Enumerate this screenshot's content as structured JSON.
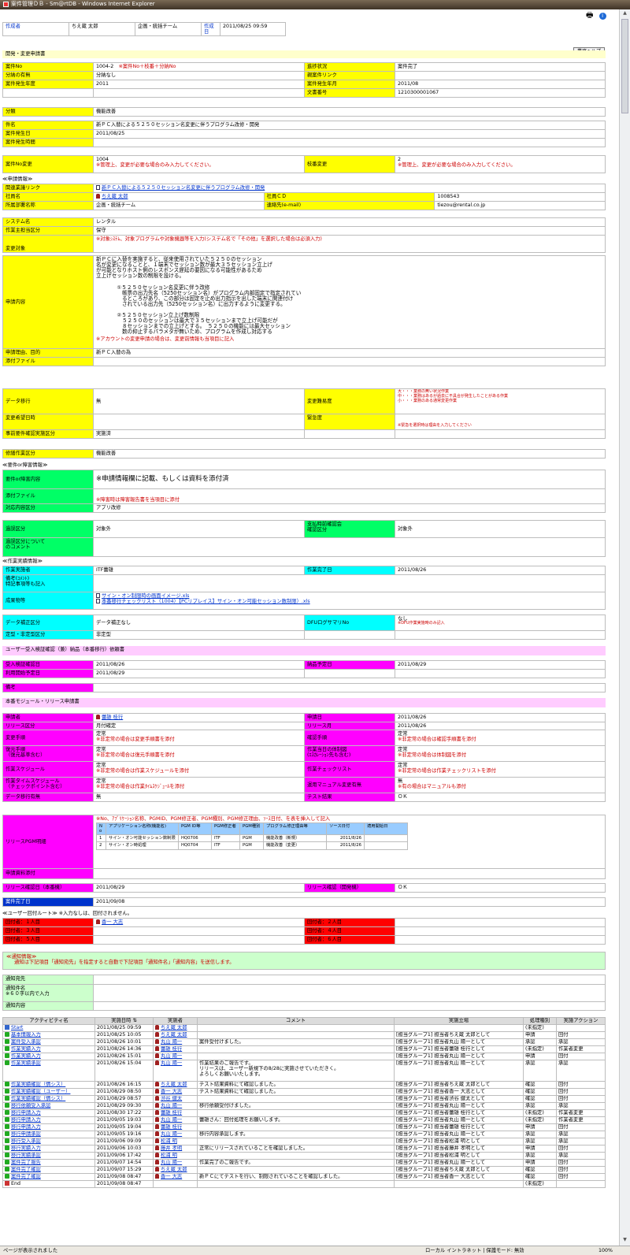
{
  "window": {
    "title": "案件管理ＤＢ - Sm@rtDB - Windows Internet Explorer"
  },
  "icons": {
    "print": "print-icon",
    "help": "help-icon",
    "user": "user-icon",
    "document": "document-icon"
  },
  "colors": {
    "yellow": "#ffff00",
    "green": "#00ff66",
    "cyan": "#00ffff",
    "magenta": "#ff00ff",
    "red": "#ff0000",
    "blue": "#0033cc",
    "pink": "#ffccff",
    "lightgreen": "#ccffcc"
  },
  "header": {
    "author_label": "作成者",
    "author": "ちえ蔵 太郎",
    "team": "企画・統括チーム",
    "date_label": "作成日",
    "date": "2011/08/25 09:59"
  },
  "help_button": "業務ヘルプ",
  "sections": {
    "request": "開発・変更申請書",
    "app_info": "≪申請情報≫",
    "incident": "≪要件or障害情報≫",
    "work": "≪作業実績情報≫",
    "uat": "ユーザー受入検証確認（兼）納品（本番移行）依頼書",
    "release": "本番モジュール・リリース申請書",
    "route": "≪ユーザー回付ルート≫ ※入力なしは、回付されません。",
    "notify": "≪通知情報≫"
  },
  "project": {
    "no_label": "案件No",
    "no": "1004-2",
    "no_note": "※案件No＋枝番＋分納No",
    "progress_label": "進捗状況",
    "progress": "案件完了",
    "split_label": "分納の有無",
    "split": "分納なし",
    "parent_label": "親案件リンク",
    "year_label": "案件発生年度",
    "year": "2011",
    "month_label": "案件発生年月",
    "month": "2011/08",
    "docno_label": "文書番号",
    "docno": "1210300001067",
    "category_label": "分類",
    "category": "機能改善",
    "subject_label": "件名",
    "subject": "新ＰＣ入替による５２５０セッション名変更に伴うプログラム改修・開発",
    "occur_date_label": "案件発生日",
    "occur_date": "2011/08/25",
    "occur_time_label": "案件発生時間",
    "change_no_label": "案件No変更",
    "change_no": "1004",
    "change_no_note": "※管理上、変更が必要な場合のみ入力してください。",
    "branch_label": "枝番変更",
    "branch": "2",
    "branch_note": "※管理上、変更が必要な場合のみ入力してください。"
  },
  "app": {
    "related_label": "関連業議リンク",
    "related_link": "新ＰＣ入替による５２５０セッション名変更に伴うプログラム改修・開発",
    "staff_label": "社員名",
    "staff": "ちえ蔵 太郎",
    "staffcd_label": "社員ＣＤ",
    "staffcd": "1008543",
    "dept_label": "所属部署名称",
    "dept": "企画・統括チーム",
    "mail_label": "連絡先(e-mail)",
    "mail": "tiezou@rental.co.jp",
    "system_label": "システム名",
    "system": "レンタル",
    "work_type_label": "作業主担当区分",
    "work_type": "保守",
    "target_note": "※対象ｼｽﾃﾑ、対象プログラムや対象機器等を入力(システム名で「その他」を選択した場合は必須入力)",
    "target_label": "変更対象",
    "content_label": "申請内容",
    "content": "新ＰＣに入替を実施すると、従来使用されていた５２５０のセッション\n名が変更になることと、１端末でセッション数が最大３５セッション立上げ\nが可能となりホスト側のレスポンス遅延の要因になる可能性があるため\n立上げセッション数の制限を設ける。\n\n　　　　①５２５０セッション名変更に伴う改修\n　　　　　帳票の出力先名（5250セッション名）がプログラム内部固定で指定されてい\n　　　　　るところがあり、この部分は固定を止め出力指示を出した端末に関連付け\n　　　　　されている出力先（5250セッション名）に出力するように変更する。\n\n　　　　②５２５０セッション立上げ数制限\n　　　　　５２５０のセッションは最大で３５セッションまで立上げ可能だが\n　　　　　８セッションまでの立上げとする。　５２５０の機能には最大セッション\n　　　　　数の抑止するパラメタが無いため、プログラムを作成し対応する",
    "content_note": "※アカウントの変更申請の場合は、変更前情報も当項目に記入",
    "reason_label": "申請理由、目的",
    "reason": "新ＰＣ入替の為",
    "attach_label": "添付ファイル",
    "migration_label": "データ移行",
    "migration": "無",
    "difficulty_label": "変更難易度",
    "difficulty_big": "大・・・業務の無い状況作業",
    "difficulty_mid": "中・・・業務はあるが過去に不具合が発生したことがある作業",
    "difficulty_small": "小・・・業務のある通常変更作業",
    "desired_label": "変更希望日時",
    "urgency_label": "緊急度",
    "urgency_note": "※緊急を選択時は理由を入力してください",
    "precheck_label": "事前要件確認実施区分",
    "precheck": "実施済",
    "repair_label": "修繕作業区分",
    "repair": "機能改善"
  },
  "incident": {
    "content_label": "要件or障害内容",
    "content": "※申請情報欄に記載、もしくは資料を添付済",
    "attach_label": "添付ファイル",
    "attach_note": "※障害時は障害報告書を当項目に添付",
    "response_label": "対応内容区分",
    "response": "アプリ改修",
    "fee_label": "過誤区分",
    "fee": "対象外",
    "vendor_label": "支払時前確認会\n確認区分",
    "vendor": "対象外",
    "comment_label": "過誤区分について\nのコメント"
  },
  "work": {
    "worker_label": "作業実施者",
    "worker": "ITF蕾雄",
    "done_label": "作業完了日",
    "done": "2011/08/26",
    "remark_label": "備考(ｺﾒﾝﾄ)\n特記事項等も記入",
    "output_label": "成果物等",
    "output1": "サイン・オン制限時の画面イメージ.xls",
    "output2": "本番移行チェックリスト（1004）【PCリプレイス】サイン・オン可能セッション数制限）.xls",
    "fix_label": "データ補正区分",
    "fix": "データ補正なし",
    "dfu_label": "DFUログサマリNo",
    "dfu": "なし",
    "dfu_note": "※DFU作業実施時のみ記入",
    "type_label": "定型・非定型区分",
    "type": "非定型"
  },
  "uat": {
    "accept_label": "受入検証確認日",
    "accept": "2011/08/26",
    "deliver_label": "納品予定日",
    "deliver": "2011/08/29",
    "start_label": "利用開始予定日",
    "start": "2011/08/29",
    "remark_label": "備考"
  },
  "release": {
    "applicant_label": "申請者",
    "applicant": "蕾雄 桂行",
    "app_date_label": "申請日",
    "app_date": "2011/08/26",
    "rel_type_label": "リリース区分",
    "rel_type": "月付確定",
    "rel_month_label": "リリース月",
    "rel_month": "2011/08/26",
    "procedure_label": "変更手順",
    "procedure": "定常",
    "procedure_note": "※非定常の場合は変更手順書を添付",
    "confirm_label": "確認手順",
    "confirm": "定常",
    "confirm_note": "※非定常の場合は確認手順書を添付",
    "rollback_label": "復元手順\n（復元基準含む）",
    "rollback": "定常",
    "rollback_note": "※非定常の場合は復元手順書を添付",
    "system_label": "作業当日の体制図\n(ｴｽｶﾚｰｼｮﾝ先も含む)",
    "system": "定常",
    "system_note": "※非定常の場合は体制図を添付",
    "schedule_label": "作業スケジュール",
    "schedule": "定常",
    "schedule_note": "※非定常の場合は作業スケジュールを添付",
    "checklist_label": "作業チェックリスト",
    "checklist": "定常",
    "checklist_note": "※非定常の場合は作業チェックリストを添付",
    "timetable_label": "作業タイムスケジュール\n（チェックポイント含む）",
    "timetable": "定常",
    "timetable_note": "※非定常の場合は作業ﾀｲﾑｽｹｼﾞｭｰﾙを添付",
    "manual_label": "運用マニュアル変更有無",
    "manual": "無",
    "manual_note": "※有の場合はマニュアルも添付",
    "datamig_label": "データ移行有無",
    "datamig": "無",
    "test_label": "テスト結果",
    "test": "ＯＫ",
    "pgm_label": "リリースPGM明細",
    "pgm_note": "※No、ｱﾌﾟﾘｹｰｼｮﾝ名称、PGMID、PGM修正者、PGM種別、PGM修正理由、ｿｰｽ日付、を表を挿入して記入",
    "pgm_head": [
      "No",
      "アプリケーション名称(機能名)",
      "PGM ID等",
      "PGM修正者",
      "PGM種別",
      "プログラム修正理由等",
      "ソース日付",
      "適用開始日"
    ],
    "pgm_rows": [
      [
        "1",
        "サイン・オン可能セッション数制限",
        "HQ0706",
        "ITF",
        "PGM",
        "機能改善（新規）",
        "2011/8/26",
        ""
      ],
      [
        "2",
        "サイン・オン時処理",
        "HQ0704",
        "ITF",
        "PGM",
        "機能改善（変更）",
        "2011/8/26",
        ""
      ]
    ],
    "docs_label": "申請資料添付",
    "rel_confirm_label": "リリース確認日（本番機）",
    "rel_confirm": "2011/08/29",
    "rel_check_label": "リリース確認（開発機）",
    "rel_check": "ＯＫ",
    "complete_label": "案件完了日",
    "complete": "2011/09/08"
  },
  "route": {
    "r1": "回付者：１人目",
    "r1v": "香一 大志",
    "r2": "回付者：２人目",
    "r3": "回付者：３人目",
    "r4": "回付者：４人目",
    "r5": "回付者：５人目",
    "r6": "回付者：６人目"
  },
  "notify": {
    "desc": "通知は下記項目「通知宛先」を指定すると自動で下記項目「通知件名」「通知内容」を送信します。",
    "to_label": "通知宛先",
    "subject_label": "通知件名\n※６０字以内で入力",
    "body_label": "通知内容"
  },
  "activity": {
    "headers": [
      "アクティビティ名",
      "実施日時 ⇅",
      "実施者",
      "コメント",
      "実施立場",
      "処理種別",
      "実施アクション"
    ],
    "rows": [
      {
        "name": "Start",
        "date": "2011/08/25 09:59",
        "user": "ちえ蔵 太郎",
        "comment": "",
        "role": "",
        "kind": "(未指定)",
        "action": "",
        "icon": "arr-b"
      },
      {
        "name": "基本情報入力",
        "date": "2011/08/25 10:05",
        "user": "ちえ蔵 太郎",
        "comment": "",
        "role": "[担当グループ1] 担当者ちえ蔵 太郎として",
        "kind": "申請",
        "action": "回付",
        "icon": "arr-g"
      },
      {
        "name": "案件受入承認",
        "date": "2011/08/26 10:01",
        "user": "丸山 陽一",
        "comment": "案件受付けました。",
        "role": "[担当グループ1] 担当者丸山 陽一として",
        "kind": "承認",
        "action": "承認",
        "icon": "arr-g"
      },
      {
        "name": "作業実績入力",
        "date": "2011/08/26 14:36",
        "user": "蕾雄 桂行",
        "comment": "",
        "role": "[担当グループ1] 担当者蕾雄 桂行として",
        "kind": "(未指定)",
        "action": "作業者変更",
        "icon": "arr-g"
      },
      {
        "name": "作業実績入力",
        "date": "2011/08/26 15:01",
        "user": "丸山 陽一",
        "comment": "",
        "role": "[担当グループ1] 担当者丸山 陽一として",
        "kind": "申請",
        "action": "回付",
        "icon": "arr-g"
      },
      {
        "name": "作業実績承認",
        "date": "2011/08/26 15:04",
        "user": "丸山 陽一",
        "comment": "作業結果のご報告です。\nリリースは、ユーザー新規下の8/28に実施させていただきく。\nよろしくお願いいたします。",
        "role": "[担当グループ1] 担当者丸山 陽一として",
        "kind": "承認",
        "action": "承認",
        "icon": "arr-g",
        "tall": true
      },
      {
        "name": "作業実績確認（情シス）",
        "date": "2011/08/26 16:15",
        "user": "ちえ蔵 太郎",
        "comment": "テスト結果資料にて確認しました。",
        "role": "[担当グループ1] 担当者ちえ蔵 太郎として",
        "kind": "確認",
        "action": "回付",
        "icon": "arr-g"
      },
      {
        "name": "作業実績確認（ユーザー）",
        "date": "2011/08/29 08:50",
        "user": "香一 大志",
        "comment": "テスト結果資料にて確認しました。",
        "role": "[担当グループ1] 担当者香一 大志として",
        "kind": "確認",
        "action": "回付",
        "icon": "arr-g"
      },
      {
        "name": "作業実績確認（情シス）",
        "date": "2011/08/29 08:57",
        "user": "渋谷 健太",
        "comment": "",
        "role": "[担当グループ1] 担当者渋谷 健太として",
        "kind": "確認",
        "action": "回付",
        "icon": "arr-g"
      },
      {
        "name": "移行依頼受入承認",
        "date": "2011/08/29 09:30",
        "user": "丸山 陽一",
        "comment": "移行依頼受付けました。",
        "role": "[担当グループ1] 担当者丸山 陽一として",
        "kind": "承認",
        "action": "承認",
        "icon": "arr-g"
      },
      {
        "name": "移行申請入力",
        "date": "2011/08/30 17:22",
        "user": "蕾雄 桂行",
        "comment": "",
        "role": "[担当グループ1] 担当者蕾雄 桂行として",
        "kind": "(未指定)",
        "action": "作業者変更",
        "icon": "arr-g"
      },
      {
        "name": "移行申請入力",
        "date": "2011/09/05 19:03",
        "user": "丸山 陽一",
        "comment": "蕾雄さん：回付処理をお願いします。",
        "role": "[担当グループ1] 担当者丸山 陽一として",
        "kind": "(未指定)",
        "action": "作業者変更",
        "icon": "arr-g"
      },
      {
        "name": "移行申請入力",
        "date": "2011/09/05 19:04",
        "user": "蕾雄 桂行",
        "comment": "",
        "role": "[担当グループ1] 担当者蕾雄 桂行として",
        "kind": "申請",
        "action": "回付",
        "icon": "arr-g"
      },
      {
        "name": "移行申請承認",
        "date": "2011/09/05 19:16",
        "user": "丸山 陽一",
        "comment": "移行内容承認します。",
        "role": "[担当グループ1] 担当者丸山 陽一として",
        "kind": "承認",
        "action": "承認",
        "icon": "arr-g"
      },
      {
        "name": "移行受入承認",
        "date": "2011/09/06 09:09",
        "user": "松浦 明",
        "comment": "",
        "role": "[担当グループ1] 担当者松浦 明として",
        "kind": "承認",
        "action": "承認",
        "icon": "arr-g"
      },
      {
        "name": "移行実績入力",
        "date": "2011/09/06 10:03",
        "user": "藤井 孝明",
        "comment": "正常にリリースされていることを確認しました。",
        "role": "[担当グループ1] 担当者藤井 孝明として",
        "kind": "申請",
        "action": "回付",
        "icon": "arr-g"
      },
      {
        "name": "移行実績承認",
        "date": "2011/09/06 17:42",
        "user": "松浦 明",
        "comment": "",
        "role": "[担当グループ1] 担当者松浦 明として",
        "kind": "承認",
        "action": "承認",
        "icon": "arr-g"
      },
      {
        "name": "案件完了報告",
        "date": "2011/09/07 14:54",
        "user": "丸山 陽一",
        "comment": "作業完了のご報告です。",
        "role": "[担当グループ1] 担当者丸山 陽一として",
        "kind": "申請",
        "action": "回付",
        "icon": "arr-g"
      },
      {
        "name": "案件完了確認",
        "date": "2011/09/07 15:29",
        "user": "ちえ蔵 太郎",
        "comment": "",
        "role": "[担当グループ1] 担当者ちえ蔵 太郎として",
        "kind": "確認",
        "action": "回付",
        "icon": "arr-g"
      },
      {
        "name": "案件完了確認",
        "date": "2011/09/08 08:47",
        "user": "香一 大志",
        "comment": "新ＰＣにてテストを行い、制限されていることを確認しました。",
        "role": "[担当グループ1] 担当者香一 大志として",
        "kind": "確認",
        "action": "回付",
        "icon": "arr-g"
      },
      {
        "name": "End",
        "date": "2011/09/08 08:47",
        "user": "",
        "comment": "",
        "role": "",
        "kind": "(未指定)",
        "action": "",
        "icon": "arr-r"
      }
    ]
  },
  "statusbar": {
    "left": "ページが表示されました",
    "right": "ローカル イントラネット | 保護モード: 無効",
    "zoom": "100%"
  }
}
